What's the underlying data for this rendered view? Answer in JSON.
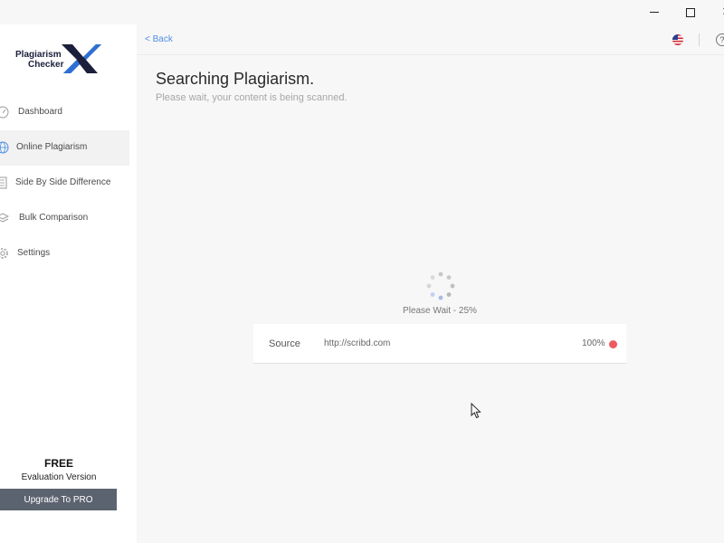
{
  "window": {
    "controls": [
      "minimize",
      "maximize",
      "close"
    ],
    "close_glyph": "✕"
  },
  "logo": {
    "line1": "Plagiarism",
    "line2": "Checker",
    "mark": "X",
    "colors": {
      "dark": "#1b1f3b",
      "blue": "#2d6fd6"
    }
  },
  "sidebar": {
    "items": [
      {
        "label": "Dashboard",
        "icon": "gauge-icon",
        "active": false
      },
      {
        "label": "Online Plagiarism",
        "icon": "globe-icon",
        "active": true
      },
      {
        "label": "Side By Side Difference",
        "icon": "document-icon",
        "active": false
      },
      {
        "label": "Bulk Comparison",
        "icon": "layers-icon",
        "active": false
      },
      {
        "label": "Settings",
        "icon": "gear-icon",
        "active": false
      }
    ],
    "plan": {
      "title": "FREE",
      "subtitle": "Evaluation Version",
      "upgrade_label": "Upgrade To PRO"
    }
  },
  "topbar": {
    "back_label": "< Back",
    "language_icon": "us-flag-icon",
    "help_icon": "help-icon",
    "help_glyph": "?"
  },
  "main": {
    "title": "Searching Plagiarism.",
    "subtitle": "Please wait, your content is being scanned.",
    "progress": {
      "label": "Please Wait - 25%",
      "percent": 25
    },
    "source": {
      "label": "Source",
      "url": "http://scribd.com",
      "percent": "100%",
      "status_color": "#ee5a5f"
    }
  },
  "colors": {
    "accent": "#4f8fe3",
    "button": "#5c6370",
    "background": "#f7f7f7"
  }
}
